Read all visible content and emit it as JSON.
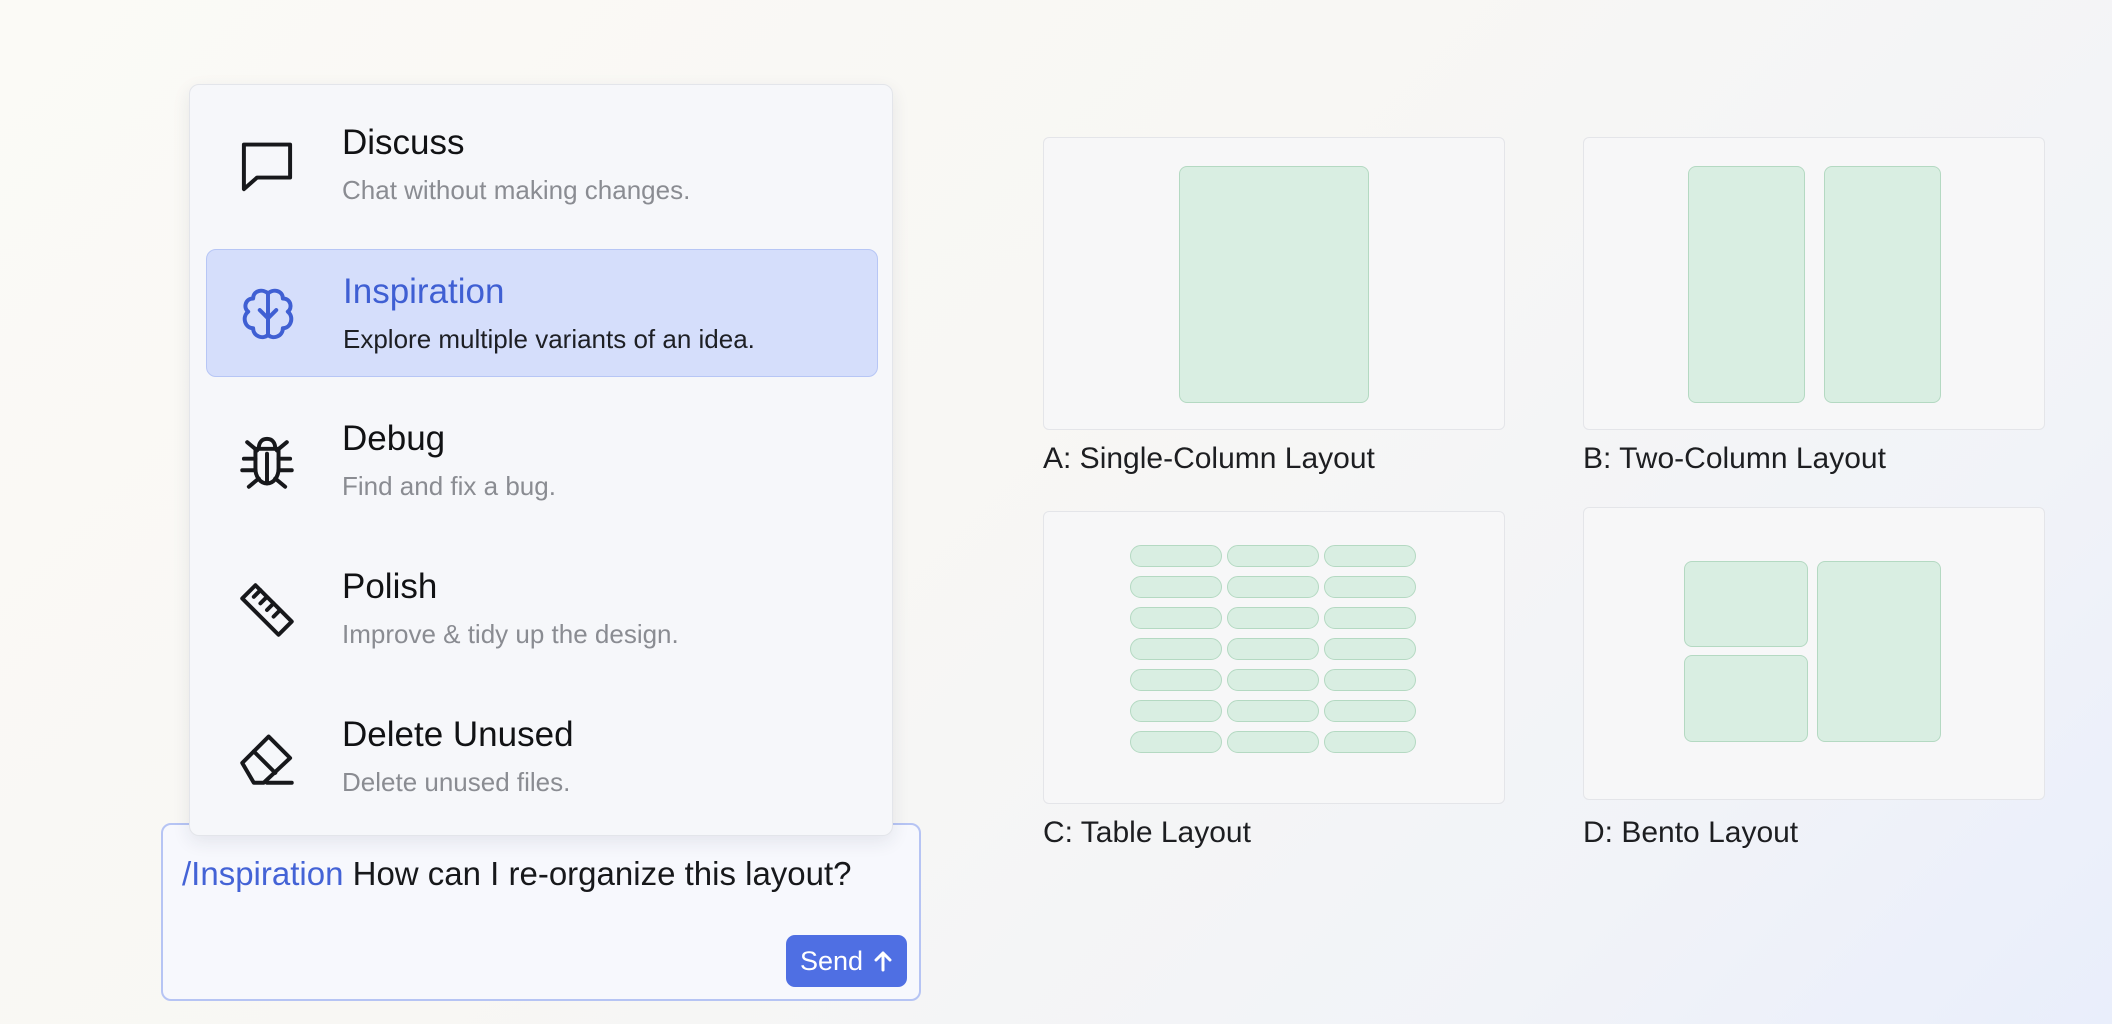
{
  "menu": {
    "items": [
      {
        "title": "Discuss",
        "description": "Chat without making changes.",
        "icon": "chat-bubble-icon"
      },
      {
        "title": "Inspiration",
        "description": "Explore multiple variants of an idea.",
        "icon": "brain-icon",
        "selected": true
      },
      {
        "title": "Debug",
        "description": "Find and fix a bug.",
        "icon": "bug-icon"
      },
      {
        "title": "Polish",
        "description": "Improve & tidy up the design.",
        "icon": "ruler-icon"
      },
      {
        "title": "Delete Unused",
        "description": "Delete unused files.",
        "icon": "eraser-icon"
      }
    ]
  },
  "chat": {
    "command": "/Inspiration",
    "message": " How can I re-organize this layout?",
    "send_label": "Send",
    "send_icon": "arrow-up-icon"
  },
  "layouts": [
    {
      "label": "A: Single-Column Layout"
    },
    {
      "label": "B: Two-Column Layout"
    },
    {
      "label": "C: Table Layout"
    },
    {
      "label": "D: Bento Layout"
    }
  ],
  "colors": {
    "accent": "#4f6fe3",
    "selected_bg": "#d5defb",
    "block_fill": "#d9eee2",
    "block_border": "#b4d9c2"
  }
}
